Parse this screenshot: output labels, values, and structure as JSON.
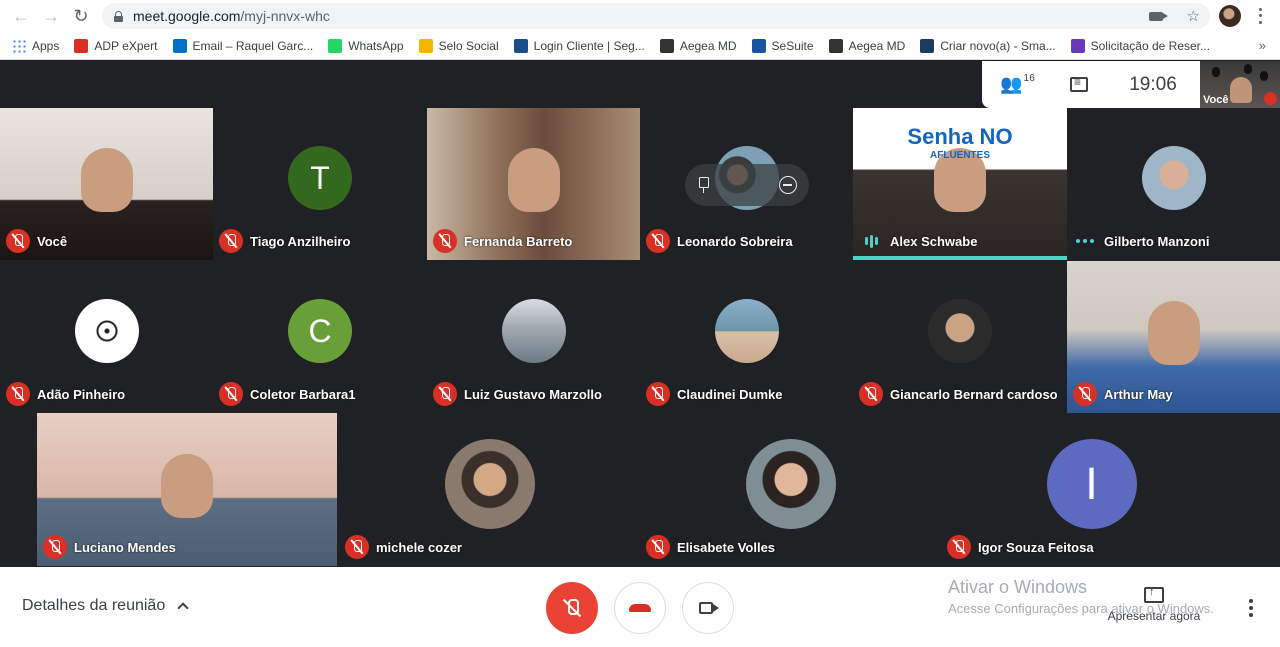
{
  "browser": {
    "url_host": "meet.google.com",
    "url_path": "/myj-nnvx-whc",
    "bookmarks": [
      {
        "label": "Apps",
        "icon": "apps-grid-icon",
        "color": "#4285f4"
      },
      {
        "label": "ADP eXpert",
        "icon": "adp-icon",
        "color": "#d93025"
      },
      {
        "label": "Email – Raquel Garc...",
        "icon": "outlook-icon",
        "color": "#0072c6"
      },
      {
        "label": "WhatsApp",
        "icon": "whatsapp-icon",
        "color": "#25d366"
      },
      {
        "label": "Selo Social",
        "icon": "selo-social-icon",
        "color": "#f4b400"
      },
      {
        "label": "Login Cliente | Seg...",
        "icon": "login-cliente-icon",
        "color": "#1a4f8b"
      },
      {
        "label": "Aegea MD",
        "icon": "graduation-cap-icon",
        "color": "#333333"
      },
      {
        "label": "SeSuite",
        "icon": "trophy-icon",
        "color": "#1a56a0"
      },
      {
        "label": "Aegea MD",
        "icon": "graduation-cap-icon",
        "color": "#333333"
      },
      {
        "label": "Criar novo(a) - Sma...",
        "icon": "check-doc-icon",
        "color": "#1f3a5f"
      },
      {
        "label": "Solicitação de Reser...",
        "icon": "forms-icon",
        "color": "#673ab7"
      }
    ],
    "more": "»"
  },
  "meet": {
    "participant_count": "16",
    "time": "19:06",
    "self_thumb_label": "Você",
    "pin_overlay": true,
    "tiles": [
      {
        "name": "Você",
        "kind": "video",
        "status": "muted"
      },
      {
        "name": "Tiago Anzilheiro",
        "kind": "initial",
        "initial": "T",
        "color": "#33691e",
        "status": "muted"
      },
      {
        "name": "Fernanda Barreto",
        "kind": "video",
        "status": "muted"
      },
      {
        "name": "Leonardo Sobreira",
        "kind": "photo",
        "status": "muted"
      },
      {
        "name": "Alex Schwabe",
        "kind": "video",
        "status": "speaking",
        "banner": "Senha NO",
        "banner_sub": "AFLUENTES"
      },
      {
        "name": "Gilberto Manzoni",
        "kind": "photo",
        "status": "dots"
      },
      {
        "name": "Adão Pinheiro",
        "kind": "photo",
        "status": "muted"
      },
      {
        "name": "Coletor Barbara1",
        "kind": "initial",
        "initial": "C",
        "color": "#689f38",
        "status": "muted"
      },
      {
        "name": "Luiz Gustavo Marzollo",
        "kind": "photo",
        "status": "muted"
      },
      {
        "name": "Claudinei Dumke",
        "kind": "photo",
        "status": "muted"
      },
      {
        "name": "Giancarlo Bernard cardoso",
        "kind": "photo",
        "status": "muted"
      },
      {
        "name": "Arthur May",
        "kind": "video",
        "status": "muted"
      },
      {
        "name": "Luciano Mendes",
        "kind": "video",
        "status": "muted"
      },
      {
        "name": "michele cozer",
        "kind": "photo",
        "status": "muted"
      },
      {
        "name": "Elisabete Volles",
        "kind": "photo",
        "status": "muted"
      },
      {
        "name": "Igor Souza Feitosa",
        "kind": "initial",
        "initial": "I",
        "color": "#5c6bc0",
        "status": "muted"
      }
    ]
  },
  "bottom": {
    "details_label": "Detalhes da reunião",
    "present_label": "Apresentar agora",
    "watermark_title": "Ativar o Windows",
    "watermark_sub": "Acesse Configurações para ativar o Windows."
  }
}
